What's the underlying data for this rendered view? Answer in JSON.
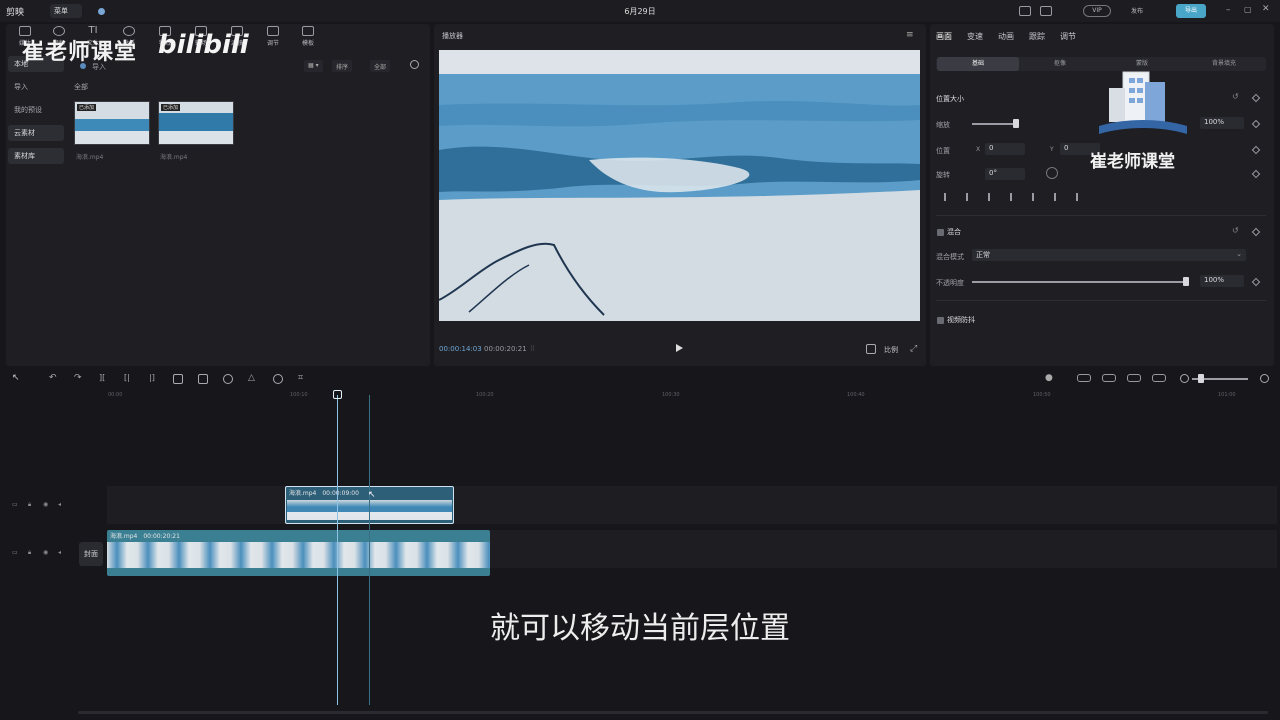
{
  "titlebar": {
    "app_name": "剪映",
    "menu_label": "菜单",
    "date": "6月29日",
    "vip": "VIP",
    "publish_label": "发布",
    "export_label": "导出"
  },
  "media_tabs": [
    {
      "label": "媒体",
      "icon": "media-icon"
    },
    {
      "label": "音频",
      "icon": "audio-icon"
    },
    {
      "label": "文本",
      "icon": "text-icon"
    },
    {
      "label": "贴纸",
      "icon": "sticker-icon"
    },
    {
      "label": "特效",
      "icon": "effects-icon"
    },
    {
      "label": "转场",
      "icon": "transition-icon"
    },
    {
      "label": "滤镜",
      "icon": "filter-icon"
    },
    {
      "label": "调节",
      "icon": "adjust-icon"
    },
    {
      "label": "模板",
      "icon": "template-icon"
    }
  ],
  "left_nav": [
    "本地",
    "导入",
    "我的预设",
    "云素材",
    "素材库"
  ],
  "media": {
    "import_label": "导入",
    "all_label": "全部",
    "sort_label": "排序",
    "filter_label": "全部",
    "items": [
      {
        "name": "海浪.mp4",
        "badge": "已添加"
      },
      {
        "name": "海浪.mp4",
        "badge": "已添加"
      }
    ]
  },
  "watermark": {
    "text": "崔老师课堂",
    "bili": "bilibili"
  },
  "player": {
    "title": "播放器",
    "current_time": "00:00:14:03",
    "total_time": "00:00:20:21",
    "ratio_label": "比例"
  },
  "props": {
    "tabs": [
      "画面",
      "变速",
      "动画",
      "跟踪",
      "调节"
    ],
    "subtabs": [
      "基础",
      "抠像",
      "蒙版",
      "背景填充"
    ],
    "position_size": "位置大小",
    "scale_label": "缩放",
    "scale_value": "100%",
    "position_label": "位置",
    "pos_x": "0",
    "pos_y": "0",
    "rotate_label": "旋转",
    "rotate_value": "0°",
    "blend_label": "混合",
    "blend_mode_label": "混合模式",
    "blend_mode_value": "正常",
    "opacity_label": "不透明度",
    "opacity_value": "100%",
    "stabilize_label": "视频防抖"
  },
  "watermark_right": {
    "text": "崔老师课堂"
  },
  "timeline": {
    "ticks": [
      "00:00",
      "100:10",
      "100:20",
      "100:30",
      "100:40",
      "100:50",
      "101:00"
    ],
    "overlay_clip": {
      "name": "海浪.mp4",
      "duration": "00:00:09:00"
    },
    "main_clip": {
      "name": "海浪.mp4",
      "duration": "00:00:20:21"
    },
    "cover_label": "封面"
  },
  "subtitle": "就可以移动当前层位置",
  "colors": {
    "accent": "#4aa6c9",
    "sea": "#3d8ab8",
    "playhead": "#8fc3e6"
  }
}
